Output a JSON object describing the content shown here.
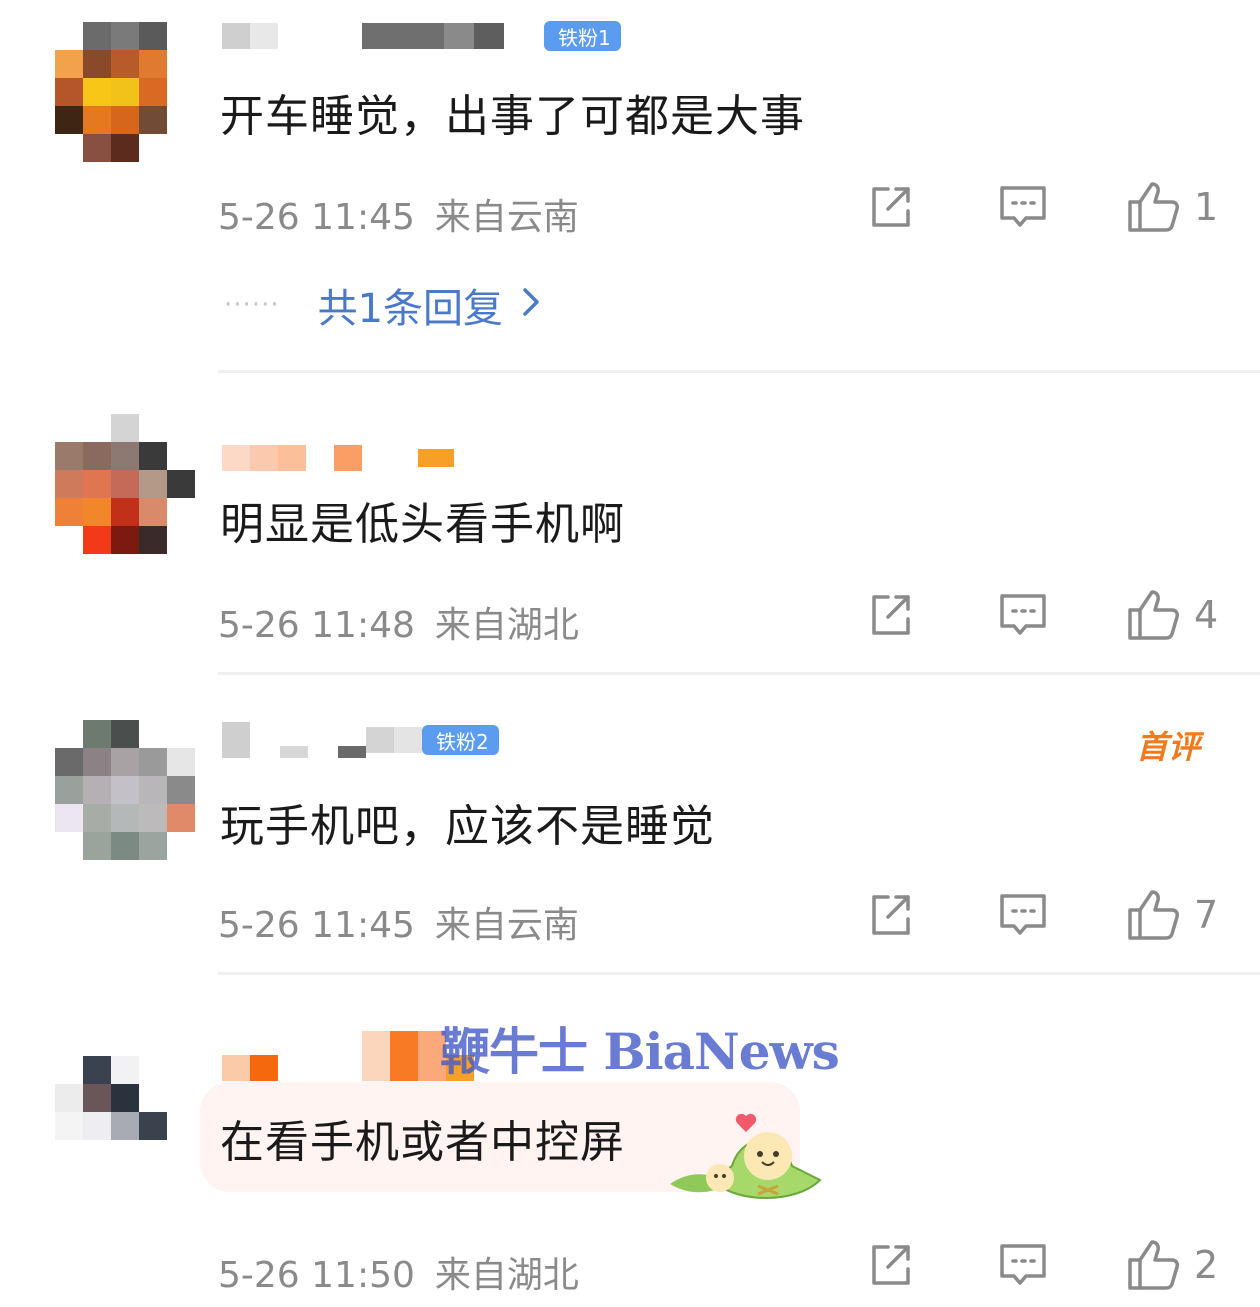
{
  "comments": [
    {
      "fan_badge": "铁粉1",
      "text": "开车睡觉，出事了可都是大事",
      "time": "5-26 11:45",
      "location": "来自云南",
      "likes": "1",
      "replies_label": "共1条回复",
      "replies_dots": "······"
    },
    {
      "text": "明显是低头看手机啊",
      "time": "5-26 11:48",
      "location": "来自湖北",
      "likes": "4"
    },
    {
      "fan_badge": "铁粉2",
      "first_label": "首评",
      "text": "玩手机吧，应该不是睡觉",
      "time": "5-26 11:45",
      "location": "来自云南",
      "likes": "7"
    },
    {
      "text": "在看手机或者中控屏",
      "time": "5-26 11:50",
      "location": "来自湖北",
      "likes": "2"
    }
  ],
  "watermark": "鞭牛士 BiaNews",
  "icons": {
    "share": "share-icon",
    "comment": "comment-icon",
    "like": "thumbs-up-icon"
  },
  "colors": {
    "link": "#4a79c9",
    "fan_badge": "#5b9cf1",
    "first_badge": "#f07a1e",
    "meta": "#8a8a8a"
  }
}
